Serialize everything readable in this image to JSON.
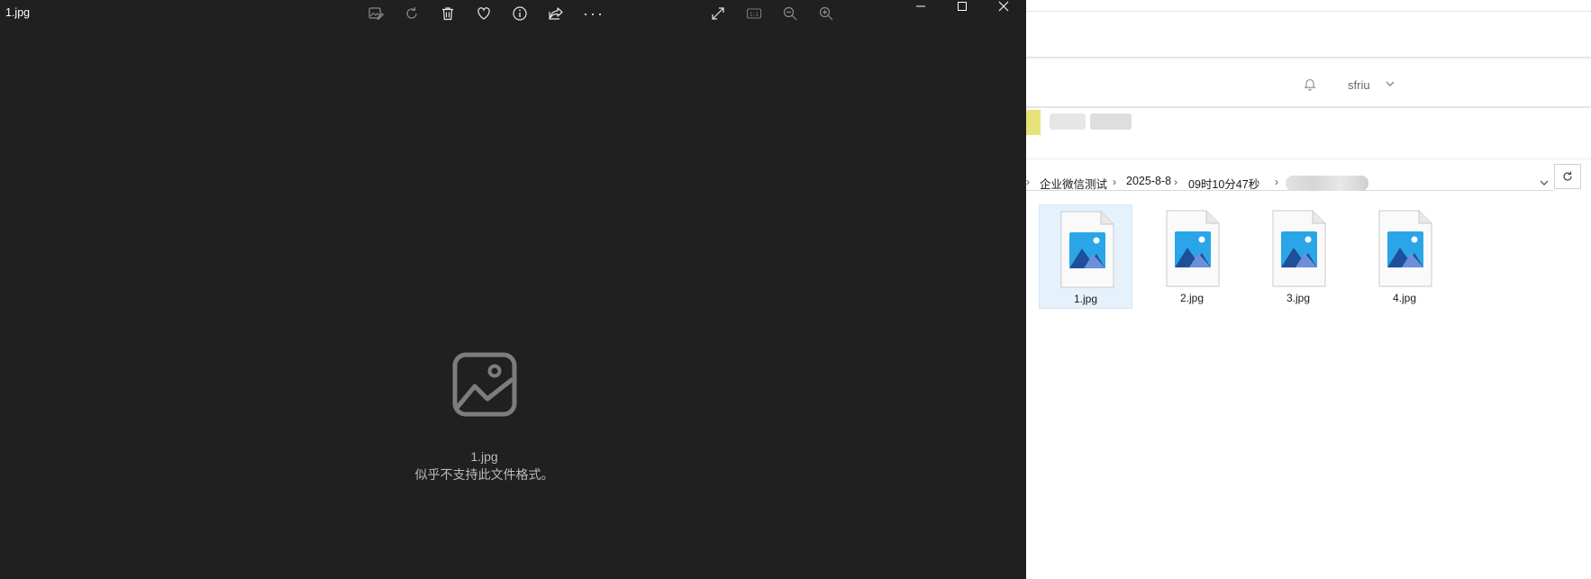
{
  "viewer": {
    "title": "1.jpg",
    "toolbar": {
      "edit": "edit-image-icon",
      "rotate": "rotate-icon",
      "delete": "delete-icon",
      "favorite": "heart-icon",
      "info": "info-icon",
      "share": "share-icon",
      "more_label": "···",
      "fullscreen": "fullscreen-icon",
      "actual_size_label": "1:1",
      "zoom_out": "zoom-out-icon",
      "zoom_in": "zoom-in-icon"
    },
    "window_controls": [
      "minimize",
      "maximize",
      "close"
    ],
    "error": {
      "file_name": "1.jpg",
      "message": "似乎不支持此文件格式。"
    }
  },
  "explorer": {
    "user_name": "sfriu",
    "breadcrumb": [
      "企业微信测试",
      "2025-8-8",
      "09时10分47秒"
    ],
    "files": [
      {
        "name": "1.jpg",
        "selected": true
      },
      {
        "name": "2.jpg",
        "selected": false
      },
      {
        "name": "3.jpg",
        "selected": false
      },
      {
        "name": "4.jpg",
        "selected": false
      }
    ],
    "colors": {
      "selection_bg": "#e5f1fb",
      "viewer_bg": "#202020",
      "image_icon_blue": "#1e88e5"
    }
  }
}
